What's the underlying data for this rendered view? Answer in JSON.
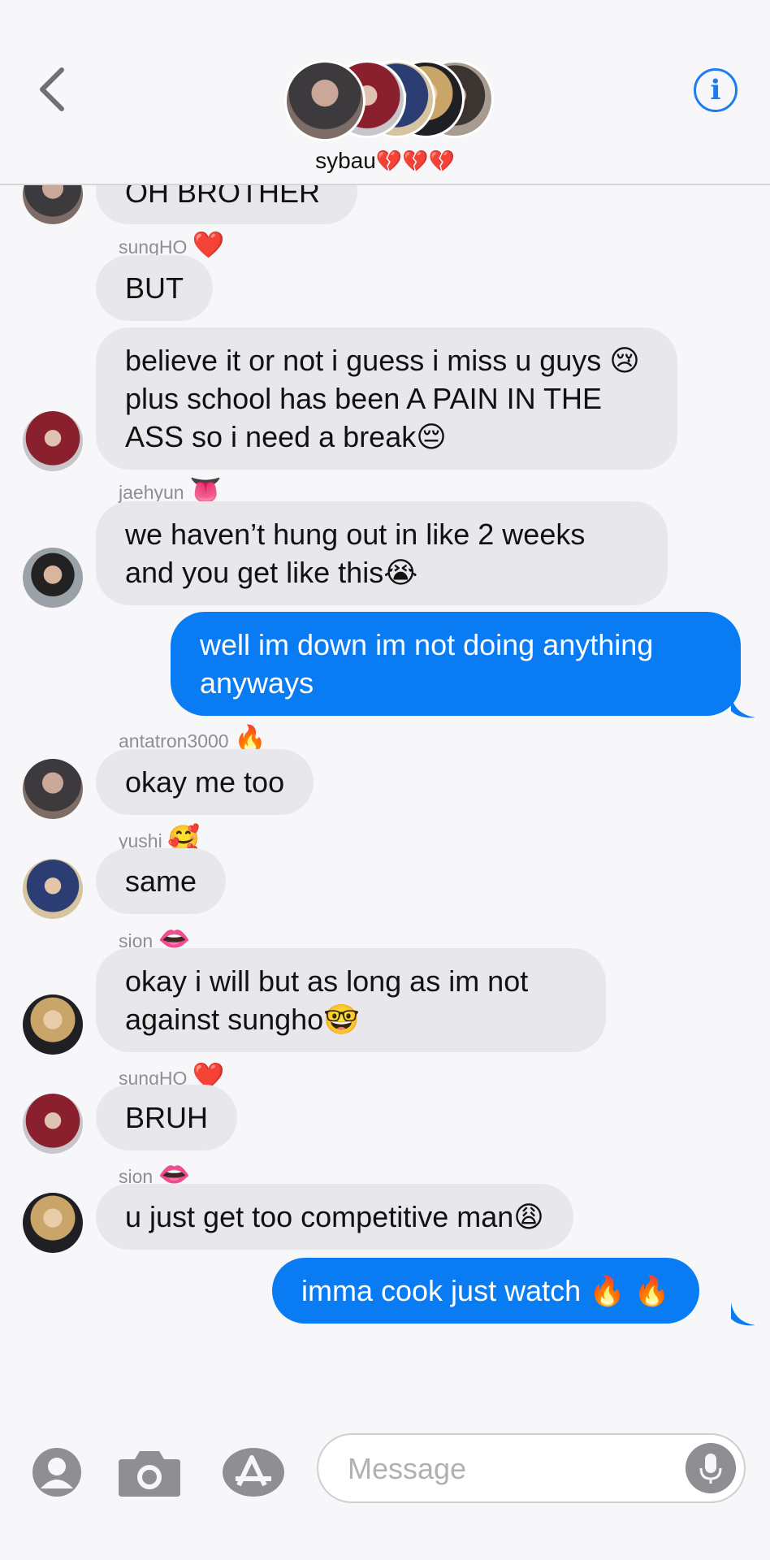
{
  "header": {
    "group_name": "sybau",
    "group_name_hearts": "💔💔💔",
    "info_label": "i"
  },
  "messages": [
    {
      "type": "in",
      "sender": "",
      "text": "OH BROTHER"
    },
    {
      "type": "sender",
      "name": "sungHO",
      "emoji": "❤️"
    },
    {
      "type": "in",
      "text": "BUT"
    },
    {
      "type": "in",
      "text": "believe it or not i guess i miss u guys 😢 plus school has been A PAIN IN THE ASS so i need a break😔"
    },
    {
      "type": "sender",
      "name": "jaehyun",
      "emoji": "👅"
    },
    {
      "type": "in",
      "text": "we haven’t hung out in like 2 weeks and you get like this😭"
    },
    {
      "type": "out",
      "text": "well im down im not doing anything anyways"
    },
    {
      "type": "sender",
      "name": "antatron3000",
      "emoji": "🔥"
    },
    {
      "type": "in",
      "text": "okay me too"
    },
    {
      "type": "sender",
      "name": "yushi",
      "emoji": "🥰"
    },
    {
      "type": "in",
      "text": "same"
    },
    {
      "type": "sender",
      "name": "sion",
      "emoji": "👄"
    },
    {
      "type": "in",
      "text": "okay i will but as long as im not against sungho🤓"
    },
    {
      "type": "sender",
      "name": "sungHO",
      "emoji": "❤️"
    },
    {
      "type": "in",
      "text": "BRUH"
    },
    {
      "type": "sender",
      "name": "sion",
      "emoji": "👄"
    },
    {
      "type": "in",
      "text": "u just get too competitive man😩"
    },
    {
      "type": "out",
      "text": "imma cook just watch 🔥 🔥"
    }
  ],
  "input": {
    "placeholder": "Message"
  },
  "icons": [
    "back-chevron-icon",
    "info-icon",
    "contact-icon",
    "camera-icon",
    "app-store-icon",
    "mic-icon"
  ],
  "colors": {
    "accent": "#0a7cf3",
    "incoming_bubble": "#e8e8ec",
    "heart": "#d32638"
  }
}
